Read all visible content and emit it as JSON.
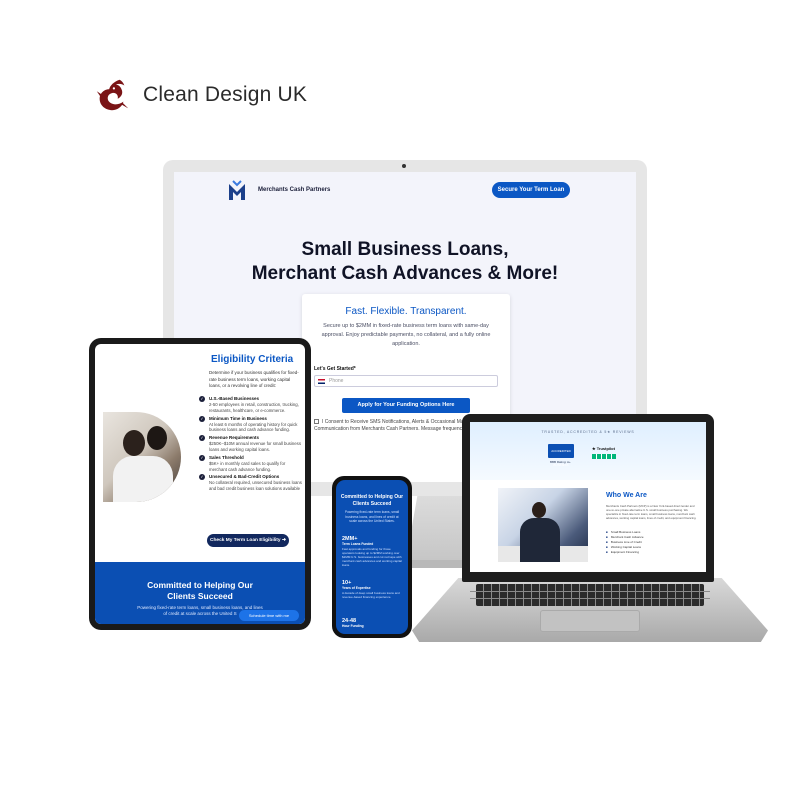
{
  "brand": {
    "name": "Clean Design UK"
  },
  "desktop": {
    "nav_brand": "Merchants Cash Partners",
    "nav_cta": "Secure Your Term Loan",
    "headline_line1": "Small Business Loans,",
    "headline_line2": "Merchant Cash Advances & More!",
    "card_title": "Fast. Flexible. Transparent.",
    "card_body": "Secure up to $2MM in fixed-rate business term loans with same-day approval. Enjoy predictable payments, no collateral, and a fully online application.",
    "field_label": "Let's Get Started*",
    "field_placeholder": "Phone",
    "apply_button": "Apply for Your Funding Options Here",
    "consent_text": "I Consent to Receive SMS Notifications, Alerts & Occasional Marketing Communication from Merchants Cash Partners. Message frequency"
  },
  "tablet": {
    "title": "Eligibility Criteria",
    "intro": "Determine if your business qualifies for fixed-rate business term loans, working capital loans, or a revolving line of credit:",
    "criteria": [
      {
        "heading": "U.S.-Based Businesses",
        "detail": "2-50 employees in retail, construction, trucking, restaurants, healthcare, or e-commerce."
      },
      {
        "heading": "Minimum Time in Business",
        "detail": "At least 6 months of operating history for quick business loans and cash advance funding."
      },
      {
        "heading": "Revenue Requirements",
        "detail": "$250K–$10M annual revenue for small business loans and working capital loans."
      },
      {
        "heading": "Sales Threshold",
        "detail": "$5K+ in monthly card sales to qualify for merchant cash advance funding."
      },
      {
        "heading": "Unsecured & Bad-Credit Options",
        "detail": "No collateral required, unsecured business loans and bad credit business loan solutions available"
      }
    ],
    "check_button": "Check My Term Loan Eligibility",
    "band_title_line1": "Committed to Helping Our",
    "band_title_line2": "Clients Succeed",
    "band_text": "Powering fixed-rate term loans, small business loans, and lines of credit at scale across the United S",
    "schedule_button": "Schedule time with me"
  },
  "phone": {
    "title_line1": "Committed to Helping Our",
    "title_line2": "Clients Succeed",
    "text": "Powering fixed-rate term loans, small business loans, and lines of credit at scale across the United States.",
    "stats": [
      {
        "value": "2MM+",
        "label": "Term Loans Funded",
        "detail": "Fast approvals and funding for those operators looking up to $2MM working over $2MM U.S. businesses and cut red tape with merchant cash advances and working capital loans."
      },
      {
        "value": "10+",
        "label": "Years of Expertise",
        "detail": "A decade of deep small business loans and revenue-based financing experience."
      },
      {
        "value": "24-48",
        "label": "Hour Funding",
        "detail": ""
      }
    ]
  },
  "laptop": {
    "band_title": "TRUSTED, ACCREDITED & 5★ REVIEWS",
    "badge_bbb": "ACCREDITED BUSINESS",
    "badge_bbb_sub": "BBB Rating: A+",
    "badge_trustpilot": "★ Trustpilot",
    "title": "Who We Are",
    "text": "Merchants Cash Partners (MCP) is a New York-based direct lender and one-to-one private alternative U.S. small business purchasing. We specialize in fixed-rate term loans, small business loans, merchant cash advances, working capital loans, lines of credit, and equipment financing.",
    "products": [
      "Small Business Loans",
      "Merchant Cash Advance",
      "Business Line of Credit",
      "Working Capital Loans",
      "Equipment Financing"
    ]
  }
}
